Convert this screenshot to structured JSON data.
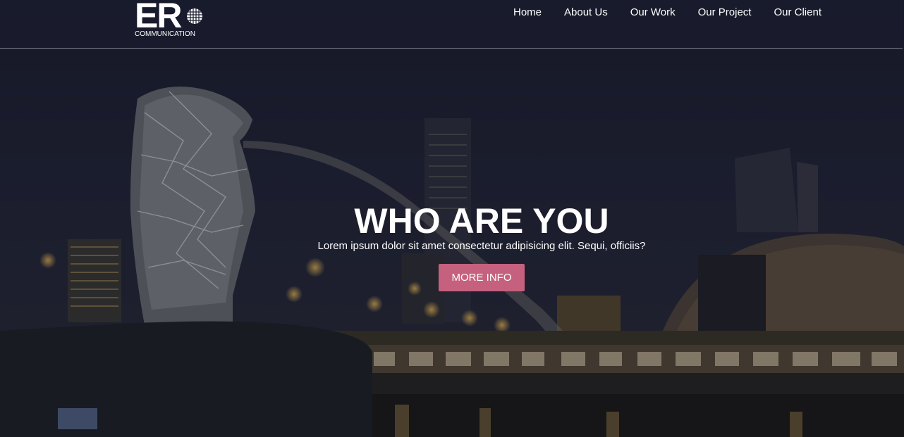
{
  "brand": {
    "logo_main": "ER",
    "logo_sub": "COMMUNICATION"
  },
  "nav": {
    "items": [
      "Home",
      "About Us",
      "Our Work",
      "Our Project",
      "Our Client"
    ]
  },
  "hero": {
    "title": "WHO ARE YOU",
    "subtitle": "Lorem ipsum dolor sit amet consectetur adipisicing elit. Sequi, officiis?",
    "button_label": "MORE INFO"
  },
  "colors": {
    "accent": "#c5617e",
    "overlay": "#1b1d2e",
    "text": "#ffffff"
  },
  "icons": {
    "globe": "globe-icon"
  }
}
